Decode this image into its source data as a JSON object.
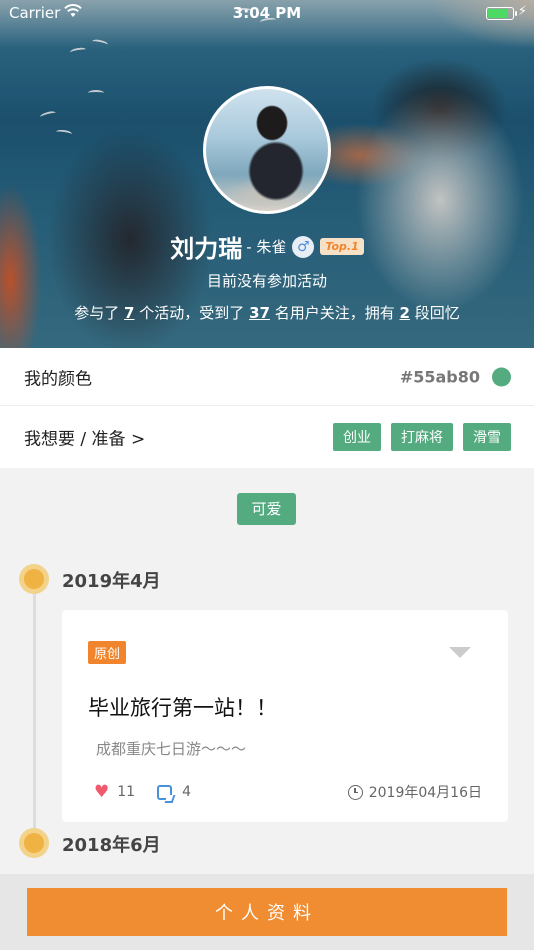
{
  "status_bar": {
    "carrier": "Carrier",
    "time": "3:04 PM"
  },
  "profile": {
    "name": "刘力瑞",
    "alias": "- 朱雀",
    "gender_symbol": "♂",
    "rank_badge": "Top.1",
    "activity_status": "目前没有参加活动",
    "stats": {
      "prefix": "参与了",
      "activities": "7",
      "mid1": "个活动，受到了",
      "followers": "37",
      "mid2": "名用户关注，拥有",
      "memories": "2",
      "suffix": "段回忆"
    }
  },
  "color_row": {
    "label": "我的颜色",
    "code": "#55ab80",
    "color": "#55ab80"
  },
  "want_row": {
    "label": "我想要 / 准备 >",
    "tags": [
      "创业",
      "打麻将",
      "滑雪"
    ]
  },
  "personality_tag": "可爱",
  "timeline": [
    {
      "date": "2019年4月",
      "card": {
        "badge": "原创",
        "title": "毕业旅行第一站！！",
        "desc": "成都重庆七日游～～～",
        "likes": "11",
        "comments": "4",
        "timestamp": "2019年04月16日"
      }
    },
    {
      "date": "2018年6月"
    }
  ],
  "bottom_button": "个人资料",
  "colors": {
    "accent_green": "#55ab80",
    "accent_orange": "#f08c32",
    "timeline_dot": "#f0b242"
  }
}
